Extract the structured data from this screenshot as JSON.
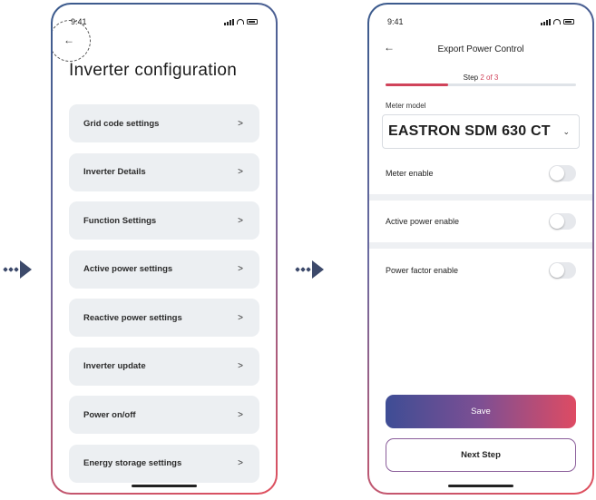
{
  "colors": {
    "accent": "#d0435a",
    "arrow": "#3d4a6b"
  },
  "screen1": {
    "time": "9:41",
    "back_icon": "←",
    "title": "Inverter configuration",
    "chevron": ">",
    "items": [
      {
        "label": "Grid code settings"
      },
      {
        "label": "Inverter Details"
      },
      {
        "label": "Function Settings"
      },
      {
        "label": "Active power settings"
      },
      {
        "label": "Reactive power settings"
      },
      {
        "label": "Inverter update"
      },
      {
        "label": "Power on/off"
      },
      {
        "label": "Energy storage settings"
      }
    ]
  },
  "screen2": {
    "time": "9:41",
    "back_icon": "←",
    "title": "Export Power Control",
    "step_prefix": "Step",
    "step_current": "2 of 3",
    "step_progress": 0.33,
    "meter_label": "Meter model",
    "meter_value": "EASTRON SDM 630 CT",
    "caret": "⌄",
    "toggles": [
      {
        "label": "Meter enable",
        "on": false
      },
      {
        "label": "Active power enable",
        "on": false
      },
      {
        "label": "Power factor enable",
        "on": false
      }
    ],
    "save_label": "Save",
    "next_label": "Next Step"
  }
}
